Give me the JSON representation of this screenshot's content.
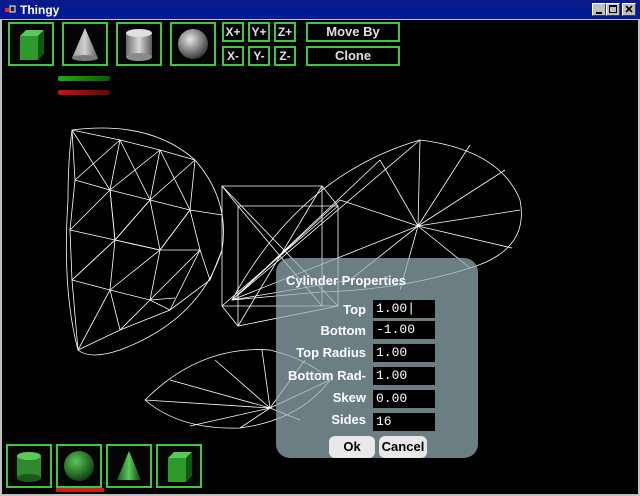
{
  "window": {
    "title": "Thingy"
  },
  "toolbar": {
    "shapes": [
      {
        "name": "cube-tool"
      },
      {
        "name": "cone-tool"
      },
      {
        "name": "cylinder-tool"
      },
      {
        "name": "sphere-tool"
      }
    ],
    "axis_buttons": {
      "x_plus": "X+",
      "y_plus": "Y+",
      "z_plus": "Z+",
      "x_minus": "X-",
      "y_minus": "Y-",
      "z_minus": "Z-"
    },
    "move_by": "Move By",
    "clone": "Clone"
  },
  "colors": {
    "accent_green": "#3ec83e",
    "indicator_green": "#16b016",
    "indicator_red": "#d01010",
    "panel": "#94b0b6"
  },
  "properties": {
    "title": "Cylinder Properties",
    "fields": [
      {
        "label": "Top",
        "value": "1.00|"
      },
      {
        "label": "Bottom",
        "value": "-1.00"
      },
      {
        "label": "Top Radius",
        "value": "1.00"
      },
      {
        "label": "Bottom Rad-",
        "value": "1.00"
      },
      {
        "label": "Skew",
        "value": "0.00"
      },
      {
        "label": "Sides",
        "value": "16"
      }
    ],
    "ok": "Ok",
    "cancel": "Cancel"
  },
  "object_list": [
    {
      "name": "cylinder"
    },
    {
      "name": "sphere"
    },
    {
      "name": "cone"
    },
    {
      "name": "cube"
    }
  ]
}
